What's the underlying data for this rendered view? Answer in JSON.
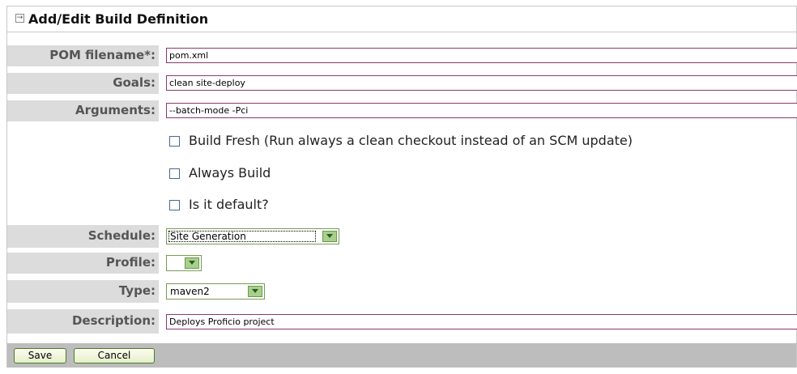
{
  "panel": {
    "title": "Add/Edit Build Definition"
  },
  "form": {
    "pom_filename": {
      "label": "POM filename*:",
      "value": "pom.xml"
    },
    "goals": {
      "label": "Goals:",
      "value": "clean site-deploy"
    },
    "arguments": {
      "label": "Arguments:",
      "value": "--batch-mode -Pci"
    },
    "checkboxes": [
      {
        "label": "Build Fresh (Run always a clean checkout instead of an SCM update)",
        "checked": false
      },
      {
        "label": "Always Build",
        "checked": false
      },
      {
        "label": "Is it default?",
        "checked": false
      }
    ],
    "schedule": {
      "label": "Schedule:",
      "value": "Site Generation"
    },
    "profile": {
      "label": "Profile:",
      "value": ""
    },
    "type": {
      "label": "Type:",
      "value": "maven2"
    },
    "description": {
      "label": "Description:",
      "value": "Deploys Proficio project"
    }
  },
  "buttons": {
    "save": "Save",
    "cancel": "Cancel"
  },
  "colors": {
    "label_bg": "#dcdcdc",
    "input_border": "#8b3a6b",
    "footer_bg": "#bdbdbd",
    "button_border": "#4a7a2a"
  },
  "icons": {
    "title": "expand-icon",
    "select": "dropdown-arrow-icon"
  }
}
